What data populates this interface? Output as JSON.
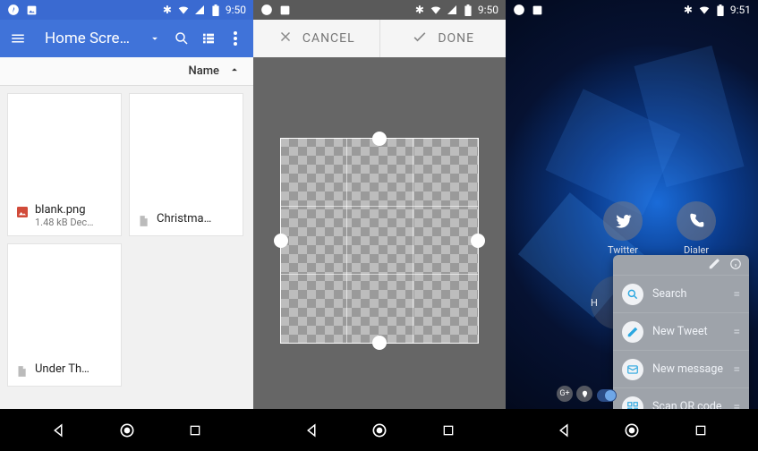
{
  "status": {
    "time_left": "9:50",
    "time_mid": "9:50",
    "time_right": "9:51"
  },
  "screen1": {
    "title": "Home Scre…",
    "sort_label": "Name",
    "files": [
      {
        "name": "blank.png",
        "meta": "1.48 kB Dec…",
        "icon": "image"
      },
      {
        "name": "Christma…",
        "meta": "",
        "icon": "file"
      },
      {
        "name": "Under Th…",
        "meta": "",
        "icon": "file"
      }
    ]
  },
  "screen2": {
    "cancel": "CANCEL",
    "done": "DONE"
  },
  "screen3": {
    "apps": [
      {
        "label": "Twitter"
      },
      {
        "label": "Dialer"
      }
    ],
    "folder_label_letter": "H",
    "popup": {
      "items": [
        {
          "label": "Search",
          "color": "#2aa7e0",
          "icon": "search"
        },
        {
          "label": "New Tweet",
          "color": "#2aa7e0",
          "icon": "compose"
        },
        {
          "label": "New message",
          "color": "#2aa7e0",
          "icon": "message"
        },
        {
          "label": "Scan QR code",
          "color": "#2aa7e0",
          "icon": "qr"
        }
      ]
    },
    "pills": {
      "gplus": "G+"
    }
  }
}
